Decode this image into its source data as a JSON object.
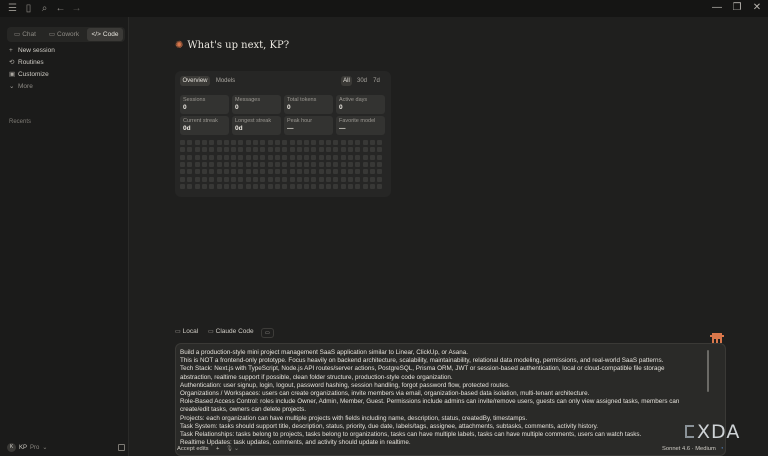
{
  "titlebar": {
    "icons": [
      "menu-icon",
      "sidebar-toggle-icon",
      "search-icon",
      "back-arrow-icon",
      "forward-arrow-icon"
    ],
    "window_controls": [
      "minimize-icon",
      "restore-icon",
      "close-icon"
    ]
  },
  "sidebar": {
    "modes": [
      {
        "label": "Chat",
        "icon": "chat-icon",
        "active": false
      },
      {
        "label": "Cowork",
        "icon": "cowork-icon",
        "active": false
      },
      {
        "label": "Code",
        "icon": "code-icon",
        "active": true
      }
    ],
    "nav": [
      {
        "label": "New session",
        "icon": "plus-icon"
      },
      {
        "label": "Routines",
        "icon": "routines-icon"
      },
      {
        "label": "Customize",
        "icon": "customize-icon"
      },
      {
        "label": "More",
        "icon": "chevron-down-icon"
      }
    ],
    "recents_label": "Recents",
    "user": {
      "initials": "K",
      "name": "KP",
      "plan": "Pro"
    }
  },
  "main": {
    "greeting": "What's up next, KP?",
    "stats": {
      "tabs": [
        "Overview",
        "Models"
      ],
      "active_tab": "Overview",
      "ranges": [
        "All",
        "30d",
        "7d"
      ],
      "active_range": "All",
      "cards": [
        {
          "label": "Sessions",
          "value": "0"
        },
        {
          "label": "Messages",
          "value": "0"
        },
        {
          "label": "Total tokens",
          "value": "0"
        },
        {
          "label": "Active days",
          "value": "0"
        },
        {
          "label": "Current streak",
          "value": "0d"
        },
        {
          "label": "Longest streak",
          "value": "0d"
        },
        {
          "label": "Peak hour",
          "value": "—"
        },
        {
          "label": "Favorite model",
          "value": "—"
        }
      ]
    },
    "environment": {
      "location": "Local",
      "project": "Claude Code"
    },
    "prompt_lines": [
      "Build a production-style mini project management SaaS application similar to Linear, ClickUp, or Asana.",
      "This is NOT a frontend-only prototype. Focus heavily on backend architecture, scalability, maintainability, relational data modeling, permissions, and real-world SaaS patterns.",
      "Tech Stack: Next.js with TypeScript, Node.js API routes/server actions, PostgreSQL, Prisma ORM, JWT or session-based authentication, local or cloud-compatible file storage",
      "abstraction, realtime support if possible, clean folder structure, production-style code organization.",
      "Authentication: user signup, login, logout, password hashing, session handling, forgot password flow, protected routes.",
      "Organizations / Workspaces: users can create organizations, invite members via email, organization-based data isolation, multi-tenant architecture.",
      "Role-Based Access Control: roles include Owner, Admin, Member, Guest. Permissions include admins can invite/remove users, guests can only view assigned tasks, members can",
      "create/edit tasks, owners can delete projects.",
      "Projects: each organization can have multiple projects with fields including name, description, status, createdBy, timestamps.",
      "Task System: tasks should support title, description, status, priority, due date, labels/tags, assignee, attachments, subtasks, comments, activity history.",
      "Task Relationships: tasks belong to projects, tasks belong to organizations, tasks can have multiple labels, tasks can have multiple comments, users can watch tasks.",
      "Realtime Updates: task updates, comments, and activity should update in realtime."
    ],
    "bottom_bar": {
      "mode_label": "Accept edits",
      "model_label": "Sonnet 4.6 · Medium"
    }
  },
  "watermark": "XDA"
}
